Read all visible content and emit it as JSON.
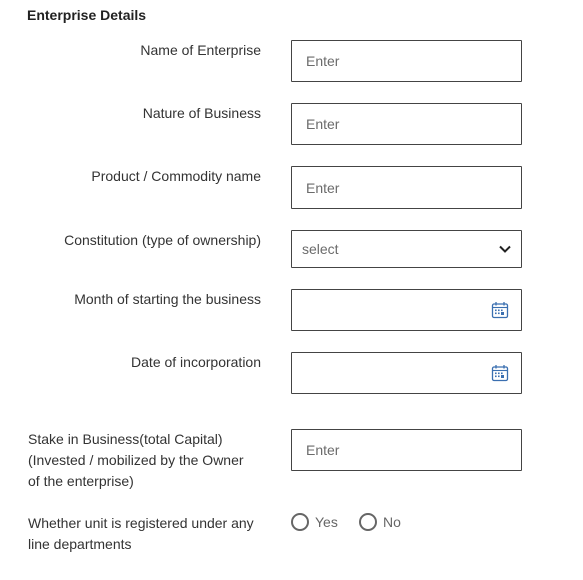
{
  "section": {
    "title": "Enterprise Details"
  },
  "fields": [
    {
      "label": "Name of Enterprise",
      "placeholder": "Enter"
    },
    {
      "label": "Nature of Business",
      "placeholder": "Enter"
    },
    {
      "label": "Product / Commodity name",
      "placeholder": "Enter"
    },
    {
      "label": "Constitution (type of ownership)",
      "placeholder": "select"
    },
    {
      "label": "Month of starting the business",
      "placeholder": ""
    },
    {
      "label": "Date of incorporation",
      "placeholder": ""
    },
    {
      "label_lines": [
        "Stake in Business(total Capital)",
        "(Invested / mobilized by the Owner",
        "of the enterprise)"
      ],
      "placeholder": "Enter"
    }
  ],
  "registered": {
    "label_lines": [
      "Whether unit is registered under any",
      "line departments"
    ],
    "options": [
      "Yes",
      "No"
    ]
  },
  "icons": {
    "select": "chevron-down-icon",
    "date": "calendar-icon"
  }
}
